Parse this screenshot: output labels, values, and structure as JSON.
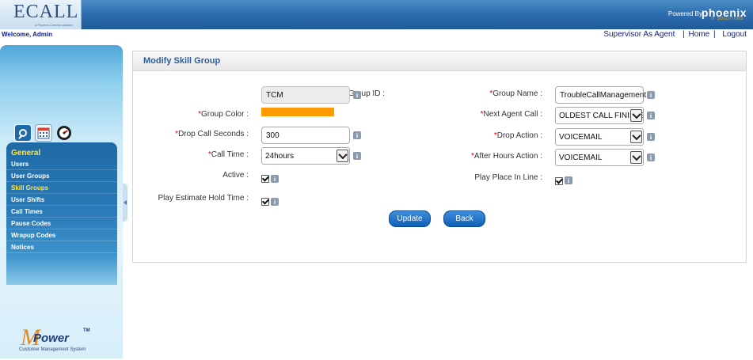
{
  "header": {
    "logo_text": "ECALL",
    "logo_tagline": "a Phoenix Contact solution",
    "powered_label": "Powered By",
    "powered_brand": "phoenix",
    "powered_brand_sub": "IT SOLUTIONS"
  },
  "welcome": "Welcome,  Admin",
  "top_links": {
    "supervisor": "Supervisor As Agent",
    "sep": "|",
    "home": "Home",
    "logout": "Logout"
  },
  "sidebar": {
    "icons": [
      "settings-tools-icon",
      "calendar-icon",
      "gauge-icon"
    ],
    "section": "General",
    "items": [
      {
        "label": "Users",
        "active": false
      },
      {
        "label": "User Groups",
        "active": false
      },
      {
        "label": "Skill Groups",
        "active": true
      },
      {
        "label": "User Shifts",
        "active": false
      },
      {
        "label": "Call Times",
        "active": false
      },
      {
        "label": "Pause Codes",
        "active": false
      },
      {
        "label": "Wrapup Codes",
        "active": false
      },
      {
        "label": "Notices",
        "active": false
      }
    ],
    "brand": {
      "m": "M",
      "word": "Power",
      "tm": "TM",
      "sub": "Customer Management System"
    }
  },
  "form": {
    "title": "Modify Skill Group",
    "required_mark": "*",
    "skill_group_id": {
      "label": "Skill Group ID :",
      "value": "TCM"
    },
    "group_color": {
      "label": "Group Color :",
      "value": "#ff9a00"
    },
    "drop_call_seconds": {
      "label": "Drop Call Seconds :",
      "value": "300"
    },
    "call_time": {
      "label": "Call Time :",
      "value": "24hours"
    },
    "active": {
      "label": "Active :",
      "checked": true
    },
    "play_estimate_hold_time": {
      "label": "Play Estimate Hold Time :",
      "checked": true
    },
    "group_name": {
      "label": "Group Name :",
      "value": "TroubleCallManagement"
    },
    "next_agent_call": {
      "label": "Next Agent Call :",
      "value": "OLDEST CALL FINISHED"
    },
    "drop_action": {
      "label": "Drop Action :",
      "value": "VOICEMAIL"
    },
    "after_hours_action": {
      "label": "After Hours Action :",
      "value": "VOICEMAIL"
    },
    "play_place_in_line": {
      "label": "Play Place In Line :",
      "checked": true
    },
    "info_glyph": "i",
    "update_label": "Update",
    "back_label": "Back"
  }
}
